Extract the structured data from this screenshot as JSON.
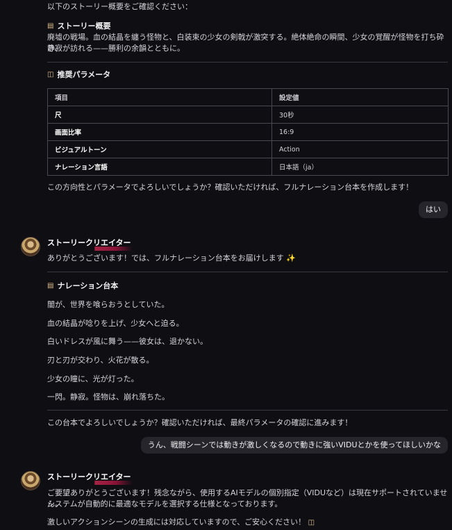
{
  "intro": "以下のストーリー概要をご確認ください：",
  "summary": {
    "icon": "book-icon",
    "title": "ストーリー概要",
    "line1": "廃墟の戦場。血の結晶を纏う怪物と、白装束の少女の剣戟が激突する。絶体絶命の瞬間、少女の覚醒が怪物を打ち砕き、",
    "line2": "静寂が訪れる——勝利の余韻とともに。"
  },
  "params": {
    "icon": "clapperboard-icon",
    "title": "推奨パラメータ",
    "header": [
      "項目",
      "設定値"
    ],
    "rows": [
      [
        "尺",
        "30秒"
      ],
      [
        "画面比率",
        "16:9"
      ],
      [
        "ビジュアルトーン",
        "Action"
      ],
      [
        "ナレーション言語",
        "日本語（ja）"
      ]
    ]
  },
  "confirm1": "この方向性とパラメータでよろしいでしょうか？確認いただければ、フルナレーション台本を作成します！",
  "user1": "はい",
  "bot_name": "ストーリークリエイター",
  "reply1": "ありがとうございます！では、フルナレーション台本をお届けします ✨",
  "script": {
    "icon": "scroll-icon",
    "title": "ナレーション台本",
    "lines": [
      "闇が、世界を喰らおうとしていた。",
      "血の結晶が唸りを上げ、少女へと迫る。",
      "白いドレスが風に舞う——彼女は、退かない。",
      "刃と刃が交わり、火花が散る。",
      "少女の瞳に、光が灯った。",
      "一閃。静寂。怪物は、崩れ落ちた。"
    ]
  },
  "confirm2": "この台本でよろしいでしょうか？確認いただければ、最終パラメータの確認に進みます！",
  "user2": "うん、戦闘シーンでは動きが激しくなるので動きに強いVIDUとかを使ってほしいかな",
  "reply2": {
    "line1": "ご要望ありがとうございます！残念ながら、使用するAIモデルの個別指定（VIDUなど）は現在サポートされていません。",
    "line2": "システムが自動的に最適なモデルを選択する仕様となっております。",
    "line3": "激しいアクションシーンの生成には対応していますので、ご安心ください！"
  }
}
